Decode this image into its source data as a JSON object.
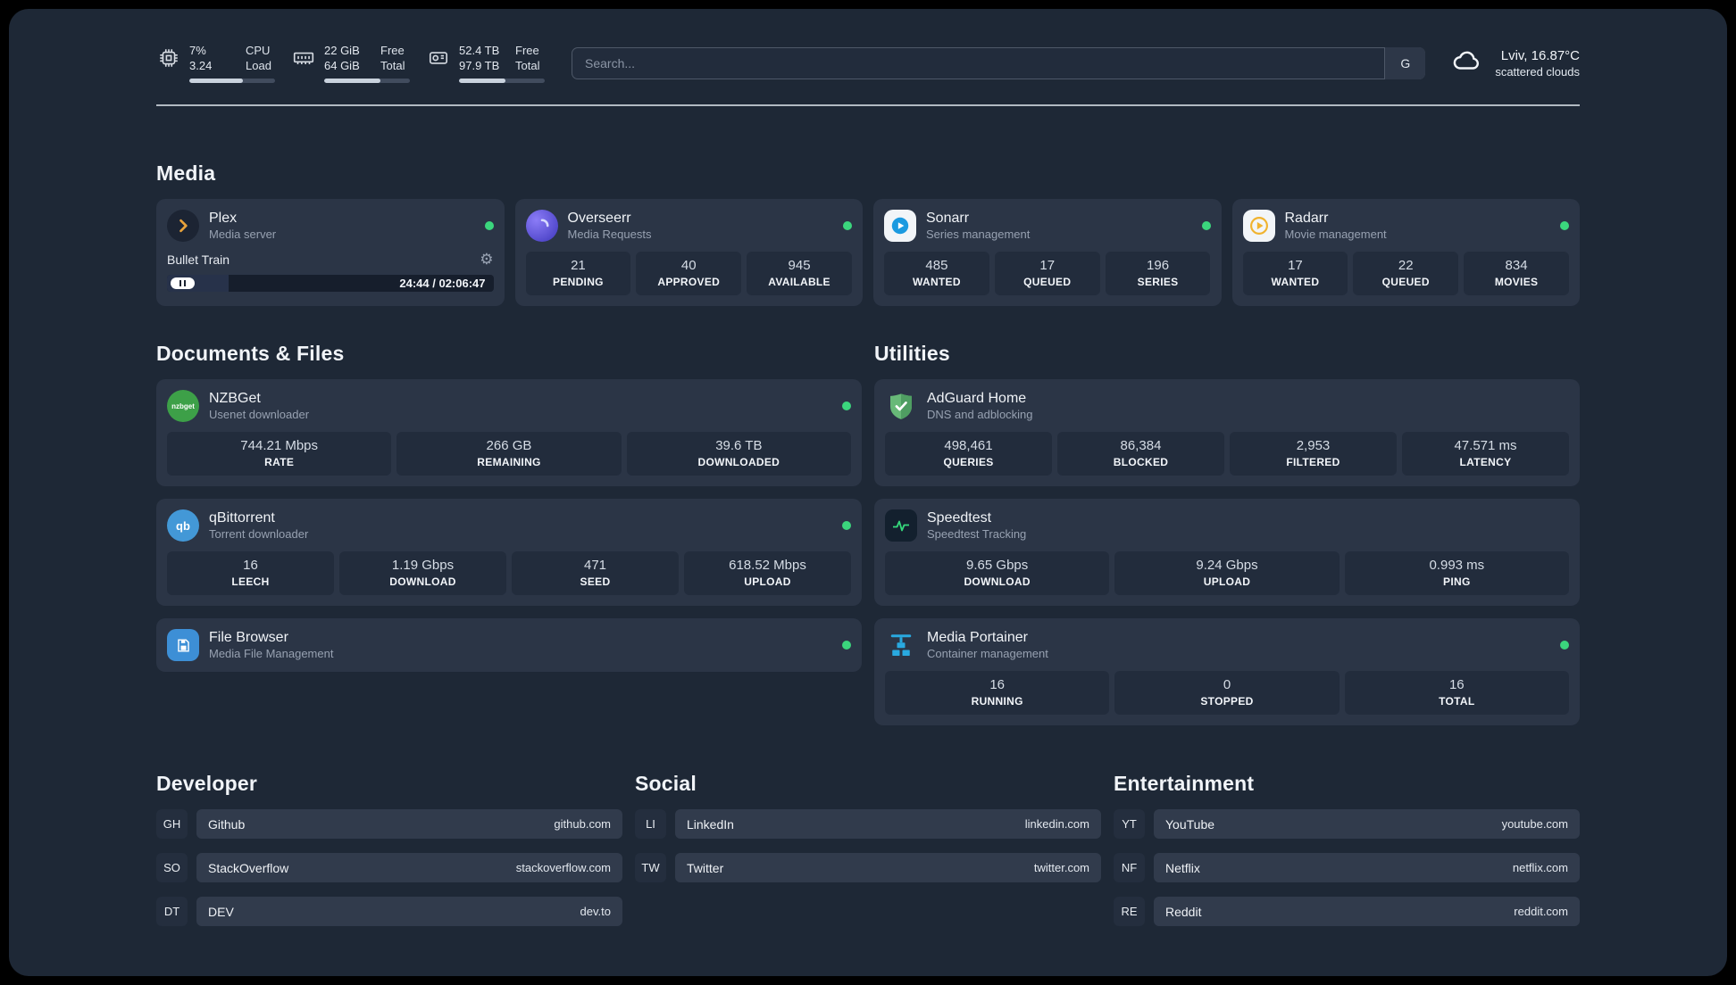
{
  "colors": {
    "status-green": "#3bd67d",
    "bar-fill": "#c9d2dd",
    "plex-amber": "#e9a33b",
    "overseerr-purple-1": "#8b7cf7",
    "overseerr-purple-2": "#4f46c9",
    "sonarr-blue": "#1b9ae0",
    "radarr-amber": "#f0b32f",
    "nzbget-green": "#3da048",
    "qbittorrent-blue": "#4398d7",
    "filebrowser-blue": "#3d8fd6",
    "adguard-green": "#68b978",
    "speedtest-green": "#35d97c",
    "portainer-blue": "#29a9e0"
  },
  "topbar": {
    "cpu": {
      "icon": "cpu-chip-icon",
      "line1_value": "7%",
      "line2_value": "3.24",
      "line1_label": "CPU",
      "line2_label": "Load",
      "progress_pct": 62
    },
    "ram": {
      "icon": "ram-icon",
      "line1_value": "22 GiB",
      "line2_value": "64 GiB",
      "line1_label": "Free",
      "line2_label": "Total",
      "progress_pct": 66
    },
    "disk": {
      "icon": "disk-icon",
      "line1_value": "52.4 TB",
      "line2_value": "97.9 TB",
      "line1_label": "Free",
      "line2_label": "Total",
      "progress_pct": 54
    },
    "search": {
      "placeholder": "Search...",
      "engine_button": "G"
    },
    "weather": {
      "icon": "cloud-icon",
      "location": "Lviv, 16.87°C",
      "condition": "scattered clouds"
    }
  },
  "media": {
    "title": "Media",
    "plex": {
      "icon": "plex-icon",
      "name": "Plex",
      "subtitle": "Media server",
      "online": true,
      "now_playing": "Bullet Train",
      "time_display": "24:44 / 02:06:47",
      "progress_pct": 19
    },
    "cards": [
      {
        "icon": "overseerr-icon",
        "name": "Overseerr",
        "subtitle": "Media Requests",
        "online": true,
        "stats": [
          {
            "value": "21",
            "label": "PENDING"
          },
          {
            "value": "40",
            "label": "APPROVED"
          },
          {
            "value": "945",
            "label": "AVAILABLE"
          }
        ]
      },
      {
        "icon": "sonarr-icon",
        "name": "Sonarr",
        "subtitle": "Series management",
        "online": true,
        "stats": [
          {
            "value": "485",
            "label": "WANTED"
          },
          {
            "value": "17",
            "label": "QUEUED"
          },
          {
            "value": "196",
            "label": "SERIES"
          }
        ]
      },
      {
        "icon": "radarr-icon",
        "name": "Radarr",
        "subtitle": "Movie management",
        "online": true,
        "stats": [
          {
            "value": "17",
            "label": "WANTED"
          },
          {
            "value": "22",
            "label": "QUEUED"
          },
          {
            "value": "834",
            "label": "MOVIES"
          }
        ]
      }
    ]
  },
  "documents": {
    "title": "Documents & Files",
    "cards": [
      {
        "icon": "nzbget-icon",
        "icon_text": "nzbget",
        "name": "NZBGet",
        "subtitle": "Usenet downloader",
        "online": true,
        "stats": [
          {
            "value": "744.21 Mbps",
            "label": "RATE"
          },
          {
            "value": "266 GB",
            "label": "REMAINING"
          },
          {
            "value": "39.6 TB",
            "label": "DOWNLOADED"
          }
        ]
      },
      {
        "icon": "qbittorrent-icon",
        "icon_text": "qb",
        "name": "qBittorrent",
        "subtitle": "Torrent downloader",
        "online": true,
        "stats": [
          {
            "value": "16",
            "label": "LEECH"
          },
          {
            "value": "1.19 Gbps",
            "label": "DOWNLOAD"
          },
          {
            "value": "471",
            "label": "SEED"
          },
          {
            "value": "618.52 Mbps",
            "label": "UPLOAD"
          }
        ]
      },
      {
        "icon": "filebrowser-icon",
        "name": "File Browser",
        "subtitle": "Media File Management",
        "online": true,
        "stats": []
      }
    ]
  },
  "utilities": {
    "title": "Utilities",
    "cards": [
      {
        "icon": "adguard-shield-icon",
        "name": "AdGuard Home",
        "subtitle": "DNS and adblocking",
        "stats": [
          {
            "value": "498,461",
            "label": "QUERIES"
          },
          {
            "value": "86,384",
            "label": "BLOCKED"
          },
          {
            "value": "2,953",
            "label": "FILTERED"
          },
          {
            "value": "47.571 ms",
            "label": "LATENCY"
          }
        ]
      },
      {
        "icon": "speedtest-pulse-icon",
        "name": "Speedtest",
        "subtitle": "Speedtest Tracking",
        "stats": [
          {
            "value": "9.65 Gbps",
            "label": "DOWNLOAD"
          },
          {
            "value": "9.24 Gbps",
            "label": "UPLOAD"
          },
          {
            "value": "0.993 ms",
            "label": "PING"
          }
        ]
      },
      {
        "icon": "portainer-crane-icon",
        "name": "Media Portainer",
        "subtitle": "Container management",
        "online": true,
        "stats": [
          {
            "value": "16",
            "label": "RUNNING"
          },
          {
            "value": "0",
            "label": "STOPPED"
          },
          {
            "value": "16",
            "label": "TOTAL"
          }
        ]
      }
    ]
  },
  "bookmarks": [
    {
      "title": "Developer",
      "links": [
        {
          "abbr": "GH",
          "name": "Github",
          "url": "github.com"
        },
        {
          "abbr": "SO",
          "name": "StackOverflow",
          "url": "stackoverflow.com"
        },
        {
          "abbr": "DT",
          "name": "DEV",
          "url": "dev.to"
        }
      ]
    },
    {
      "title": "Social",
      "links": [
        {
          "abbr": "LI",
          "name": "LinkedIn",
          "url": "linkedin.com"
        },
        {
          "abbr": "TW",
          "name": "Twitter",
          "url": "twitter.com"
        }
      ]
    },
    {
      "title": "Entertainment",
      "links": [
        {
          "abbr": "YT",
          "name": "YouTube",
          "url": "youtube.com"
        },
        {
          "abbr": "NF",
          "name": "Netflix",
          "url": "netflix.com"
        },
        {
          "abbr": "RE",
          "name": "Reddit",
          "url": "reddit.com"
        }
      ]
    }
  ]
}
